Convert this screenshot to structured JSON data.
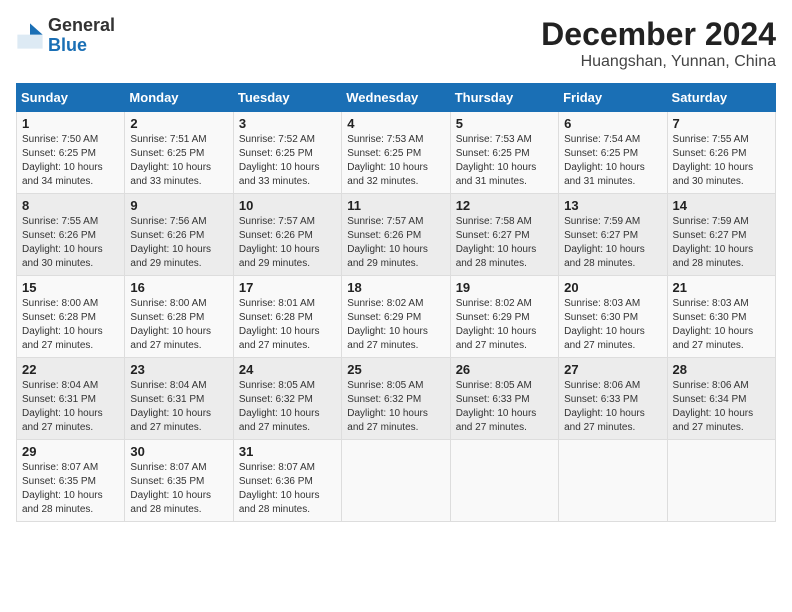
{
  "header": {
    "logo_line1": "General",
    "logo_line2": "Blue",
    "title": "December 2024",
    "subtitle": "Huangshan, Yunnan, China"
  },
  "calendar": {
    "weekdays": [
      "Sunday",
      "Monday",
      "Tuesday",
      "Wednesday",
      "Thursday",
      "Friday",
      "Saturday"
    ],
    "weeks": [
      [
        {
          "day": "",
          "detail": ""
        },
        {
          "day": "2",
          "detail": "Sunrise: 7:51 AM\nSunset: 6:25 PM\nDaylight: 10 hours\nand 33 minutes."
        },
        {
          "day": "3",
          "detail": "Sunrise: 7:52 AM\nSunset: 6:25 PM\nDaylight: 10 hours\nand 33 minutes."
        },
        {
          "day": "4",
          "detail": "Sunrise: 7:53 AM\nSunset: 6:25 PM\nDaylight: 10 hours\nand 32 minutes."
        },
        {
          "day": "5",
          "detail": "Sunrise: 7:53 AM\nSunset: 6:25 PM\nDaylight: 10 hours\nand 31 minutes."
        },
        {
          "day": "6",
          "detail": "Sunrise: 7:54 AM\nSunset: 6:25 PM\nDaylight: 10 hours\nand 31 minutes."
        },
        {
          "day": "7",
          "detail": "Sunrise: 7:55 AM\nSunset: 6:26 PM\nDaylight: 10 hours\nand 30 minutes."
        }
      ],
      [
        {
          "day": "1",
          "detail": "Sunrise: 7:50 AM\nSunset: 6:25 PM\nDaylight: 10 hours\nand 34 minutes."
        },
        {
          "day": "",
          "detail": ""
        },
        {
          "day": "",
          "detail": ""
        },
        {
          "day": "",
          "detail": ""
        },
        {
          "day": "",
          "detail": ""
        },
        {
          "day": "",
          "detail": ""
        },
        {
          "day": "",
          "detail": ""
        }
      ],
      [
        {
          "day": "8",
          "detail": "Sunrise: 7:55 AM\nSunset: 6:26 PM\nDaylight: 10 hours\nand 30 minutes."
        },
        {
          "day": "9",
          "detail": "Sunrise: 7:56 AM\nSunset: 6:26 PM\nDaylight: 10 hours\nand 29 minutes."
        },
        {
          "day": "10",
          "detail": "Sunrise: 7:57 AM\nSunset: 6:26 PM\nDaylight: 10 hours\nand 29 minutes."
        },
        {
          "day": "11",
          "detail": "Sunrise: 7:57 AM\nSunset: 6:26 PM\nDaylight: 10 hours\nand 29 minutes."
        },
        {
          "day": "12",
          "detail": "Sunrise: 7:58 AM\nSunset: 6:27 PM\nDaylight: 10 hours\nand 28 minutes."
        },
        {
          "day": "13",
          "detail": "Sunrise: 7:59 AM\nSunset: 6:27 PM\nDaylight: 10 hours\nand 28 minutes."
        },
        {
          "day": "14",
          "detail": "Sunrise: 7:59 AM\nSunset: 6:27 PM\nDaylight: 10 hours\nand 28 minutes."
        }
      ],
      [
        {
          "day": "15",
          "detail": "Sunrise: 8:00 AM\nSunset: 6:28 PM\nDaylight: 10 hours\nand 27 minutes."
        },
        {
          "day": "16",
          "detail": "Sunrise: 8:00 AM\nSunset: 6:28 PM\nDaylight: 10 hours\nand 27 minutes."
        },
        {
          "day": "17",
          "detail": "Sunrise: 8:01 AM\nSunset: 6:28 PM\nDaylight: 10 hours\nand 27 minutes."
        },
        {
          "day": "18",
          "detail": "Sunrise: 8:02 AM\nSunset: 6:29 PM\nDaylight: 10 hours\nand 27 minutes."
        },
        {
          "day": "19",
          "detail": "Sunrise: 8:02 AM\nSunset: 6:29 PM\nDaylight: 10 hours\nand 27 minutes."
        },
        {
          "day": "20",
          "detail": "Sunrise: 8:03 AM\nSunset: 6:30 PM\nDaylight: 10 hours\nand 27 minutes."
        },
        {
          "day": "21",
          "detail": "Sunrise: 8:03 AM\nSunset: 6:30 PM\nDaylight: 10 hours\nand 27 minutes."
        }
      ],
      [
        {
          "day": "22",
          "detail": "Sunrise: 8:04 AM\nSunset: 6:31 PM\nDaylight: 10 hours\nand 27 minutes."
        },
        {
          "day": "23",
          "detail": "Sunrise: 8:04 AM\nSunset: 6:31 PM\nDaylight: 10 hours\nand 27 minutes."
        },
        {
          "day": "24",
          "detail": "Sunrise: 8:05 AM\nSunset: 6:32 PM\nDaylight: 10 hours\nand 27 minutes."
        },
        {
          "day": "25",
          "detail": "Sunrise: 8:05 AM\nSunset: 6:32 PM\nDaylight: 10 hours\nand 27 minutes."
        },
        {
          "day": "26",
          "detail": "Sunrise: 8:05 AM\nSunset: 6:33 PM\nDaylight: 10 hours\nand 27 minutes."
        },
        {
          "day": "27",
          "detail": "Sunrise: 8:06 AM\nSunset: 6:33 PM\nDaylight: 10 hours\nand 27 minutes."
        },
        {
          "day": "28",
          "detail": "Sunrise: 8:06 AM\nSunset: 6:34 PM\nDaylight: 10 hours\nand 27 minutes."
        }
      ],
      [
        {
          "day": "29",
          "detail": "Sunrise: 8:07 AM\nSunset: 6:35 PM\nDaylight: 10 hours\nand 28 minutes."
        },
        {
          "day": "30",
          "detail": "Sunrise: 8:07 AM\nSunset: 6:35 PM\nDaylight: 10 hours\nand 28 minutes."
        },
        {
          "day": "31",
          "detail": "Sunrise: 8:07 AM\nSunset: 6:36 PM\nDaylight: 10 hours\nand 28 minutes."
        },
        {
          "day": "",
          "detail": ""
        },
        {
          "day": "",
          "detail": ""
        },
        {
          "day": "",
          "detail": ""
        },
        {
          "day": "",
          "detail": ""
        }
      ]
    ]
  }
}
